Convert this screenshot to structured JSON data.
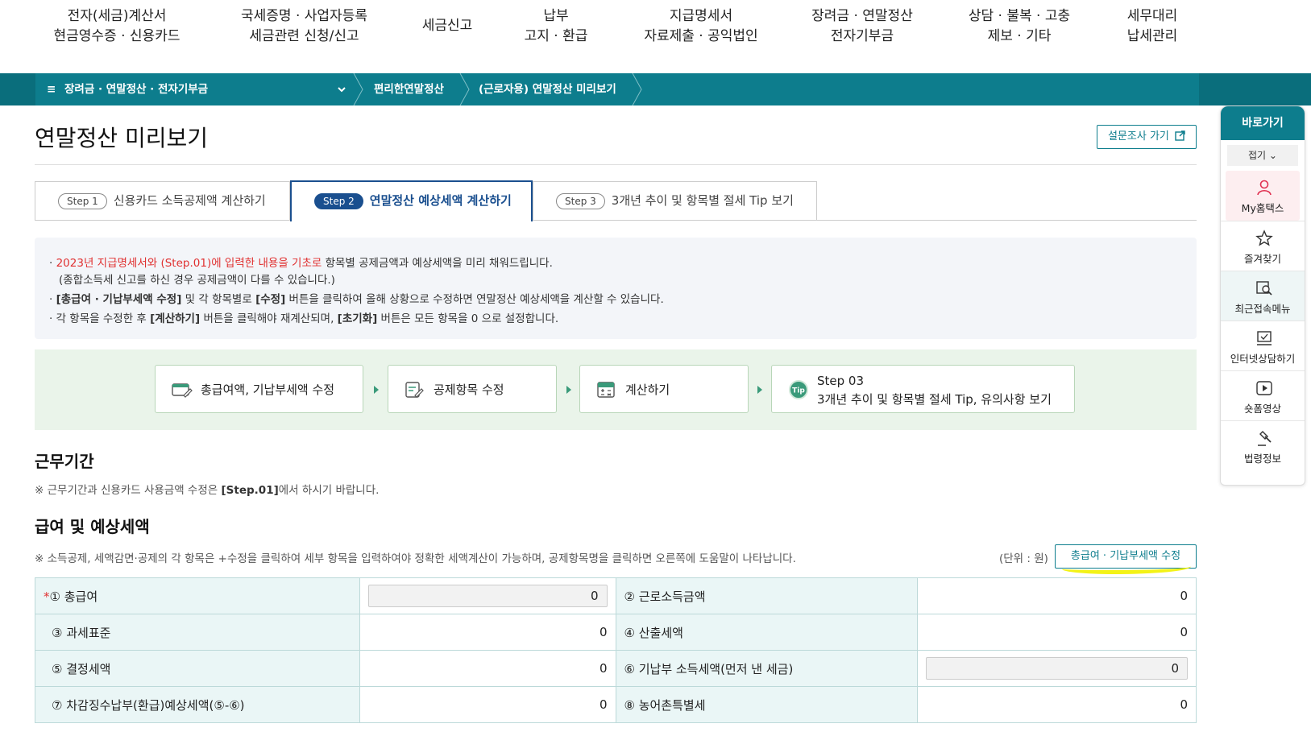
{
  "topnav": [
    {
      "line1": "전자(세금)계산서",
      "line2": "현금영수증 · 신용카드"
    },
    {
      "line1": "국세증명 · 사업자등록",
      "line2": "세금관련 신청/신고"
    },
    {
      "line1": "세금신고",
      "line2": ""
    },
    {
      "line1": "납부",
      "line2": "고지 · 환급"
    },
    {
      "line1": "지급명세서",
      "line2": "자료제출 · 공익법인"
    },
    {
      "line1": "장려금 · 연말정산",
      "line2": "전자기부금"
    },
    {
      "line1": "상담 · 불복 · 고충",
      "line2": "제보 · 기타"
    },
    {
      "line1": "세무대리",
      "line2": "납세관리"
    }
  ],
  "breadcrumb": {
    "menu": "장려금 · 연말정산 · 전자기부금",
    "level2": "편리한연말정산",
    "level3": "(근로자용) 연말정산 미리보기"
  },
  "page": {
    "title": "연말정산 미리보기",
    "survey": "설문조사 가기"
  },
  "tabs": [
    {
      "step": "Step 1",
      "label": "신용카드 소득공제액 계산하기"
    },
    {
      "step": "Step 2",
      "label": "연말정산 예상세액 계산하기"
    },
    {
      "step": "Step 3",
      "label": "3개년 추이 및 항목별 절세 Tip 보기"
    }
  ],
  "info": {
    "l1_red": "2023년 지급명세서와 (Step.01)에 입력한 내용을 기초로",
    "l1_rest": " 항목별 공제금액과 예상세액을 미리 채워드립니다.",
    "l2": "(종합소득세 신고를 하신 경우 공제금액이 다를 수 있습니다.)",
    "l3_b1": "[총급여 · 기납부세액 수정]",
    "l3_m": " 및 각 항목별로 ",
    "l3_b2": "[수정]",
    "l3_rest": " 버튼을 클릭하여 올해 상황으로 수정하면 연말정산 예상세액을 계산할 수 있습니다.",
    "l4_a": "각 항목을 수정한 후 ",
    "l4_b1": "[계산하기]",
    "l4_m": " 버튼을 클릭해야 재계산되며, ",
    "l4_b2": "[초기화]",
    "l4_rest": " 버튼은 모든 항목을 0 으로 설정합니다."
  },
  "flow": [
    {
      "label": "총급여액, 기납부세액 수정"
    },
    {
      "label": "공제항목 수정"
    },
    {
      "label": "계산하기"
    },
    {
      "label": "Step 03",
      "label2": "3개년 추이 및 항목별 절세 Tip, 유의사항 보기",
      "badge": "Tip"
    }
  ],
  "work": {
    "title": "근무기간",
    "note_a": "※ 근무기간과 신용카드 사용금액 수정은 ",
    "note_b": "[Step.01]",
    "note_c": "에서 하시기 바랍니다."
  },
  "salary": {
    "title": "급여 및 예상세액",
    "note": "※ 소득공제, 세액감면·공제의 각 항목은 +수정을 클릭하여 세부 항목을 입력하여야 정확한 세액계산이 가능하며, 공제항목명을 클릭하면 오른쪽에 도움말이 나타납니다.",
    "unit": "(단위 : 원)",
    "edit_button": "총급여 · 기납부세액 수정",
    "required": "*",
    "rows": [
      {
        "l_label": "① 총급여",
        "l_value": "0",
        "r_label": "② 근로소득금액",
        "r_value": "0"
      },
      {
        "l_label": "③ 과세표준",
        "l_value": "0",
        "r_label": "④ 산출세액",
        "r_value": "0"
      },
      {
        "l_label": "⑤ 결정세액",
        "l_value": "0",
        "r_label": "⑥ 기납부 소득세액(먼저 낸 세금)",
        "r_value": "0"
      },
      {
        "l_label": "⑦ 차감징수납부(환급)예상세액(⑤-⑥)",
        "l_value": "0",
        "r_label": "⑧ 농어촌특별세",
        "r_value": "0"
      }
    ]
  },
  "sidebar": {
    "title": "바로가기",
    "fold": "접기",
    "items": [
      "My홈택스",
      "즐겨찾기",
      "최근접속메뉴",
      "인터넷상담하기",
      "숏폼영상",
      "법령정보"
    ]
  },
  "colors": {
    "teal": "#0d7d8d",
    "navy": "#1a4f8f",
    "red": "#e03030",
    "green_bg": "#eaf4ea"
  }
}
